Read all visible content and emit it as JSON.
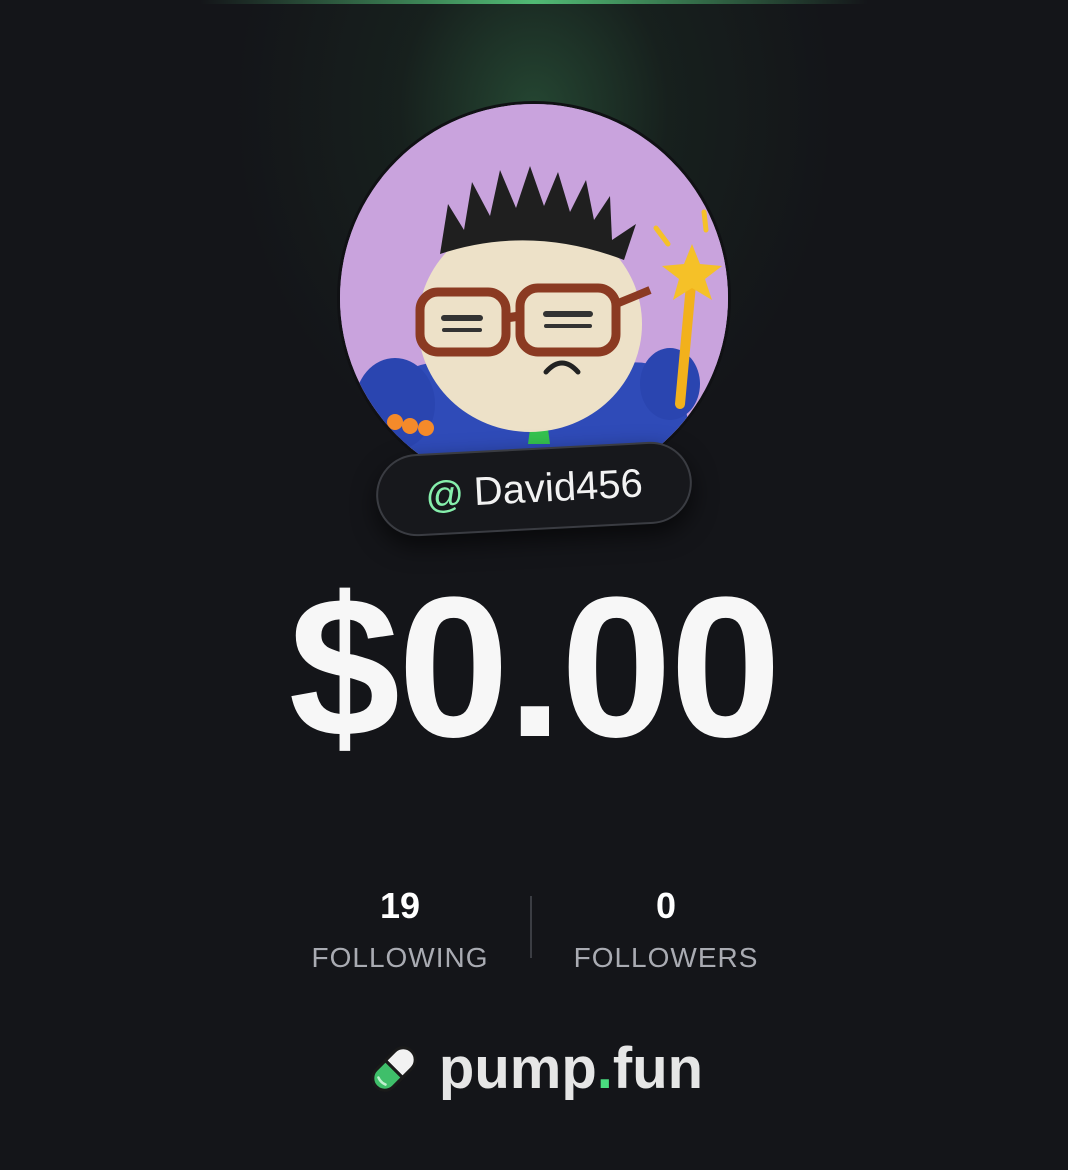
{
  "profile": {
    "handle_prefix": "@",
    "username": "David456",
    "avatar_description_icon": "clay-character-avatar"
  },
  "balance": {
    "amount": "$0.00"
  },
  "stats": {
    "following": {
      "value": "19",
      "label": "FOLLOWING"
    },
    "followers": {
      "value": "0",
      "label": "FOLLOWERS"
    }
  },
  "brand": {
    "name_part1": "pump",
    "name_dot": ".",
    "name_part2": "fun",
    "icon": "pill-icon"
  },
  "colors": {
    "background": "#141519",
    "accent_green": "#4ade80",
    "handle_at": "#86efac",
    "label_gray": "#a9abb2"
  }
}
